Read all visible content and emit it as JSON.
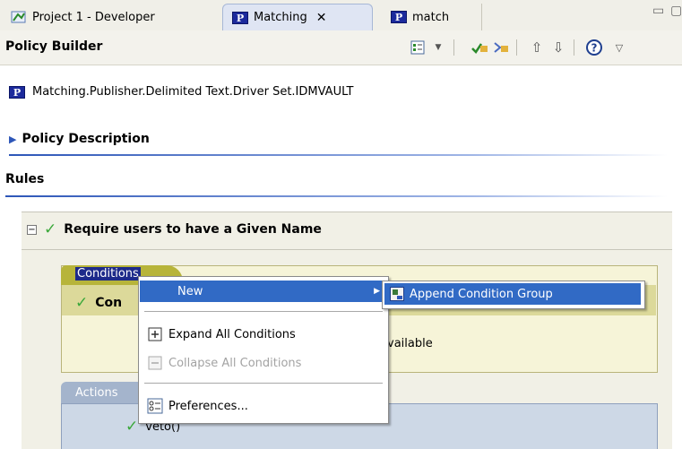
{
  "tabs": [
    {
      "label": "Project 1 - Developer",
      "icon": "project-icon",
      "active": false
    },
    {
      "label": "Matching",
      "icon": "policy-icon",
      "active": true,
      "closable": true
    },
    {
      "label": "match",
      "icon": "policy-icon",
      "active": false
    }
  ],
  "header": {
    "title": "Policy Builder",
    "toolbar": [
      "edit-rules-icon",
      "dropdown-arrow-icon",
      "enable-icon",
      "disable-icon",
      "move-up-icon",
      "move-down-icon",
      "help-icon",
      "view-menu-icon"
    ]
  },
  "policy": {
    "path": "Matching.Publisher.Delimited Text.Driver Set.IDMVAULT",
    "description_label": "Policy Description",
    "rules_label": "Rules"
  },
  "rule": {
    "title": "Require users to have a Given Name",
    "conditions_tab": "Conditions",
    "condition_row_prefix": "Con",
    "condition_body_text": "vailable",
    "actions_tab": "Actions",
    "action_row": "veto()"
  },
  "context_menu": {
    "items": [
      {
        "label": "New",
        "has_submenu": true,
        "selected": true
      },
      {
        "label": "Expand All Conditions",
        "enabled": true
      },
      {
        "label": "Collapse All Conditions",
        "enabled": false
      },
      {
        "label": "Preferences...",
        "enabled": true
      }
    ],
    "submenu": [
      {
        "label": "Append Condition Group",
        "selected": true
      }
    ]
  },
  "colors": {
    "selection": "#316ac5",
    "condition_tab": "#b7b43a",
    "actions_tab": "#a4b4cc",
    "accent_line": "#2d56b8"
  }
}
